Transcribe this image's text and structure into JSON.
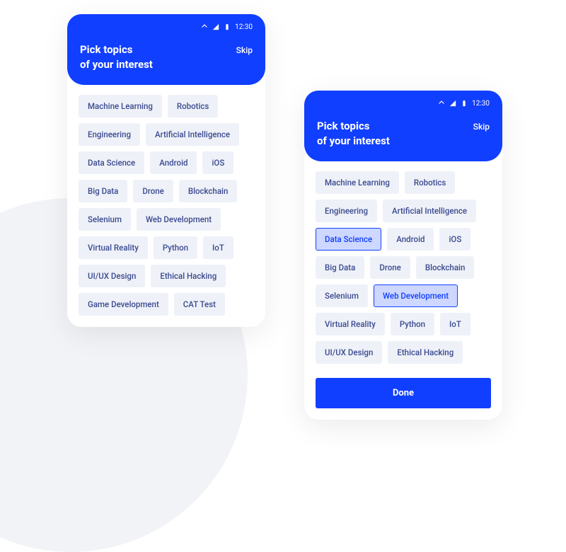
{
  "status": {
    "time": "12:30"
  },
  "header": {
    "title_line1": "Pick topics",
    "title_line2": "of your interest",
    "skip_label": "Skip"
  },
  "topics": [
    "Machine Learning",
    "Robotics",
    "Engineering",
    "Artificial Intelligence",
    "Data Science",
    "Android",
    "iOS",
    "Big Data",
    "Drone",
    "Blockchain",
    "Selenium",
    "Web Development",
    "Virtual Reality",
    "Python",
    "IoT",
    "UI/UX Design",
    "Ethical Hacking",
    "Game Development",
    "CAT Test"
  ],
  "screens": {
    "left": {
      "selected": [],
      "show_done": false,
      "visible_count": 19
    },
    "right": {
      "selected": [
        "Data Science",
        "Web Development"
      ],
      "show_done": true,
      "visible_count": 17
    }
  },
  "done_label": "Done"
}
